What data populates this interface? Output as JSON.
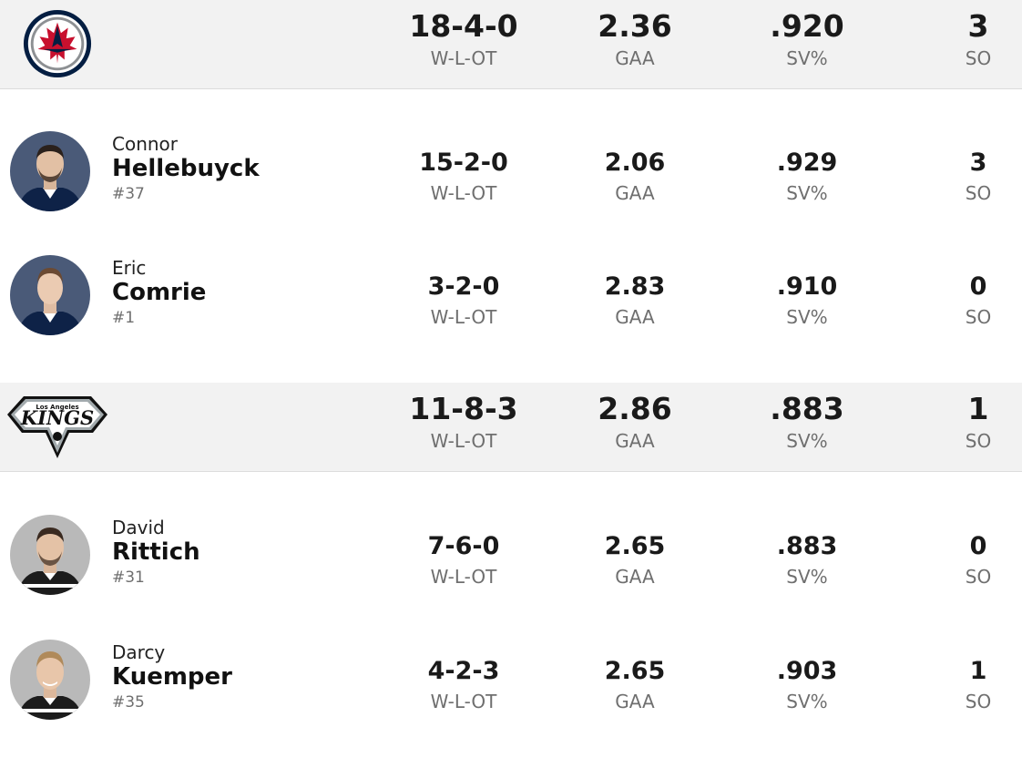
{
  "teams": [
    {
      "logo_icon": "winnipeg-jets-logo",
      "stats": [
        {
          "value": "18-4-0",
          "label": "W-L-OT"
        },
        {
          "value": "2.36",
          "label": "GAA"
        },
        {
          "value": ".920",
          "label": "SV%"
        },
        {
          "value": "3",
          "label": "SO"
        }
      ],
      "players": [
        {
          "first": "Connor",
          "last": "Hellebuyck",
          "number": "#37",
          "stats": [
            {
              "value": "15-2-0",
              "label": "W-L-OT"
            },
            {
              "value": "2.06",
              "label": "GAA"
            },
            {
              "value": ".929",
              "label": "SV%"
            },
            {
              "value": "3",
              "label": "SO"
            }
          ]
        },
        {
          "first": "Eric",
          "last": "Comrie",
          "number": "#1",
          "stats": [
            {
              "value": "3-2-0",
              "label": "W-L-OT"
            },
            {
              "value": "2.83",
              "label": "GAA"
            },
            {
              "value": ".910",
              "label": "SV%"
            },
            {
              "value": "0",
              "label": "SO"
            }
          ]
        }
      ]
    },
    {
      "logo_icon": "la-kings-logo",
      "logo_text_top": "Los Angeles",
      "logo_text": "KINGS",
      "stats": [
        {
          "value": "11-8-3",
          "label": "W-L-OT"
        },
        {
          "value": "2.86",
          "label": "GAA"
        },
        {
          "value": ".883",
          "label": "SV%"
        },
        {
          "value": "1",
          "label": "SO"
        }
      ],
      "players": [
        {
          "first": "David",
          "last": "Rittich",
          "number": "#31",
          "stats": [
            {
              "value": "7-6-0",
              "label": "W-L-OT"
            },
            {
              "value": "2.65",
              "label": "GAA"
            },
            {
              "value": ".883",
              "label": "SV%"
            },
            {
              "value": "0",
              "label": "SO"
            }
          ]
        },
        {
          "first": "Darcy",
          "last": "Kuemper",
          "number": "#35",
          "stats": [
            {
              "value": "4-2-3",
              "label": "W-L-OT"
            },
            {
              "value": "2.65",
              "label": "GAA"
            },
            {
              "value": ".903",
              "label": "SV%"
            },
            {
              "value": "1",
              "label": "SO"
            }
          ]
        }
      ]
    }
  ]
}
